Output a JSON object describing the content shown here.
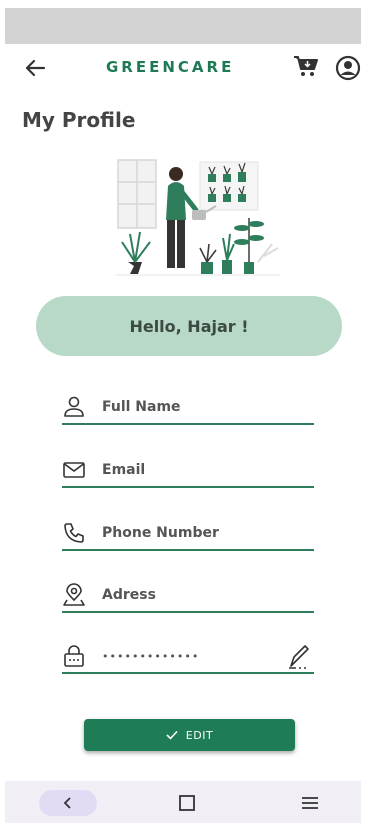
{
  "app": {
    "brand": "GREENCARE"
  },
  "page": {
    "title": "My Profile"
  },
  "greeting": "Hello, Hajar !",
  "fields": [
    {
      "label": "Full Name",
      "icon": "person-icon"
    },
    {
      "label": "Email",
      "icon": "envelope-icon"
    },
    {
      "label": "Phone Number",
      "icon": "phone-icon"
    },
    {
      "label": "Adress",
      "icon": "location-pin-icon"
    }
  ],
  "password": {
    "value": "•••••••••••••",
    "icon": "lock-icon",
    "action_icon": "pen-icon"
  },
  "edit_button": {
    "label": "EDIT",
    "icon": "checkmark-icon"
  },
  "colors": {
    "brand": "#1f7a53",
    "accent": "#1e7d56",
    "greeting_bg": "#b8d8c8",
    "underline": "#2e7d5b"
  }
}
